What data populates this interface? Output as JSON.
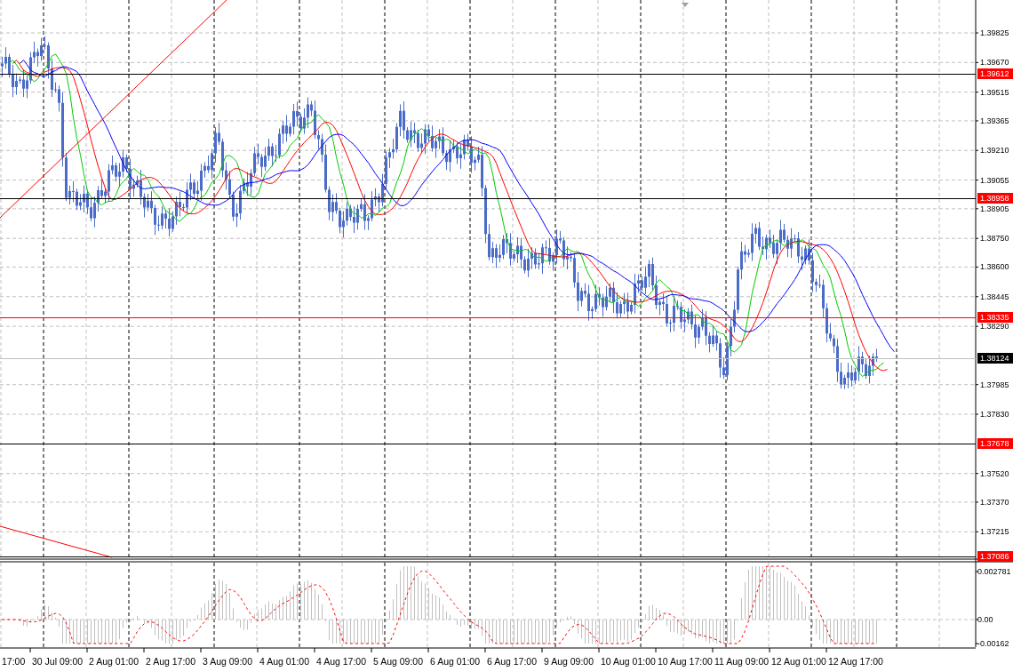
{
  "price_axis": {
    "labels": [
      "1.39825",
      "1.39670",
      "1.39515",
      "1.39365",
      "1.39210",
      "1.39055",
      "1.38905",
      "1.38750",
      "1.38600",
      "1.38445",
      "1.38290",
      "1.37985",
      "1.37830",
      "1.37520",
      "1.37370",
      "1.37215"
    ]
  },
  "price_levels": [
    {
      "label": "1.39612",
      "kind": "level",
      "color": "#000000"
    },
    {
      "label": "1.38958",
      "kind": "level",
      "color": "#000000"
    },
    {
      "label": "1.38335",
      "kind": "level",
      "color": "#ff0000"
    },
    {
      "label": "1.38124",
      "kind": "current",
      "color": "#c0c0c0"
    },
    {
      "label": "1.37678",
      "kind": "level",
      "color": "#000000"
    },
    {
      "label": "1.37086",
      "kind": "level",
      "color": "#000000"
    }
  ],
  "indicator_axis": {
    "labels": [
      "0.002781",
      "0.00",
      "-0.00162"
    ]
  },
  "time_axis": {
    "labels": [
      "17:00",
      "30 Jul 09:00",
      "2 Aug 01:00",
      "2 Aug 17:00",
      "3 Aug 09:00",
      "4 Aug 01:00",
      "4 Aug 17:00",
      "5 Aug 09:00",
      "6 Aug 01:00",
      "6 Aug 17:00",
      "9 Aug 09:00",
      "10 Aug 01:00",
      "10 Aug 17:00",
      "11 Aug 09:00",
      "12 Aug 01:00",
      "12 Aug 17:00"
    ]
  }
}
